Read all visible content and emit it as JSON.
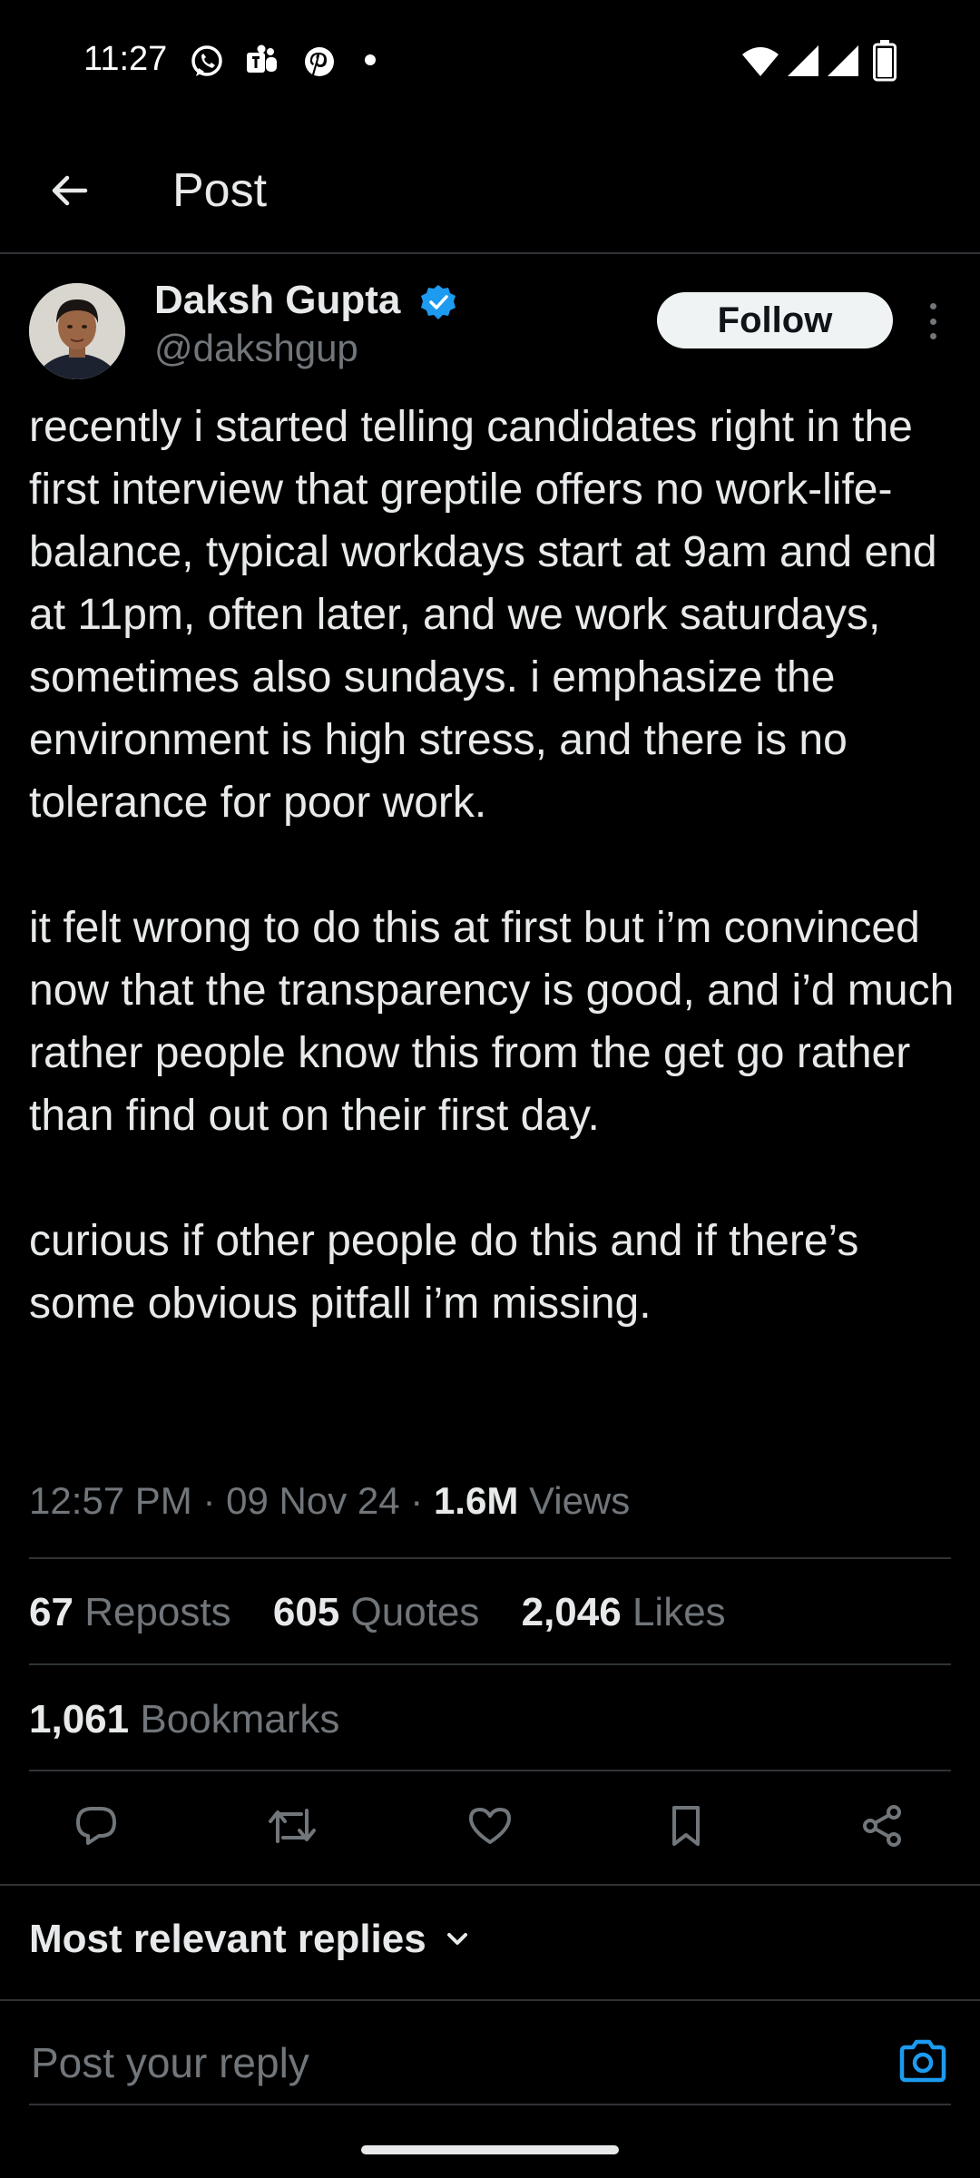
{
  "status_bar": {
    "time": "11:27",
    "notification_icons": [
      "whatsapp-icon",
      "teams-icon",
      "pinterest-icon",
      "more-notifications-dot"
    ],
    "system_icons": [
      "wifi-icon",
      "signal-icon",
      "signal-icon",
      "battery-icon"
    ]
  },
  "header": {
    "back_icon": "arrow-left-icon",
    "title": "Post"
  },
  "author": {
    "name": "Daksh Gupta",
    "handle": "@dakshgup",
    "verified": true,
    "follow_label": "Follow"
  },
  "tweet": {
    "text": "recently i started telling candidates right in the first interview that greptile offers no work-life-balance, typical workdays start at 9am and end at 11pm, often later, and we work saturdays, sometimes also sundays. i emphasize the environment is high stress, and there is no tolerance for poor work.\n\nit felt wrong to do this at first but i’m convinced now that the transparency is good, and i’d much rather people know this from the get go rather than find out on their first day.\n\ncurious if other people do this and if there’s some obvious pitfall i’m missing.",
    "time": "12:57 PM",
    "date": "09 Nov 24",
    "separator": "·",
    "views_count": "1.6M",
    "views_label": "Views"
  },
  "stats": {
    "reposts_count": "67",
    "reposts_label": "Reposts",
    "quotes_count": "605",
    "quotes_label": "Quotes",
    "likes_count": "2,046",
    "likes_label": "Likes",
    "bookmarks_count": "1,061",
    "bookmarks_label": "Bookmarks"
  },
  "actions": [
    "reply-icon",
    "repost-icon",
    "like-icon",
    "bookmark-icon",
    "share-icon"
  ],
  "replies": {
    "sort_label": "Most relevant replies"
  },
  "reply_box": {
    "placeholder": "Post your reply"
  },
  "colors": {
    "background": "#000000",
    "text": "#e7e9ea",
    "muted": "#71767b",
    "accent": "#1d9bf0",
    "divider": "#2f3336"
  }
}
